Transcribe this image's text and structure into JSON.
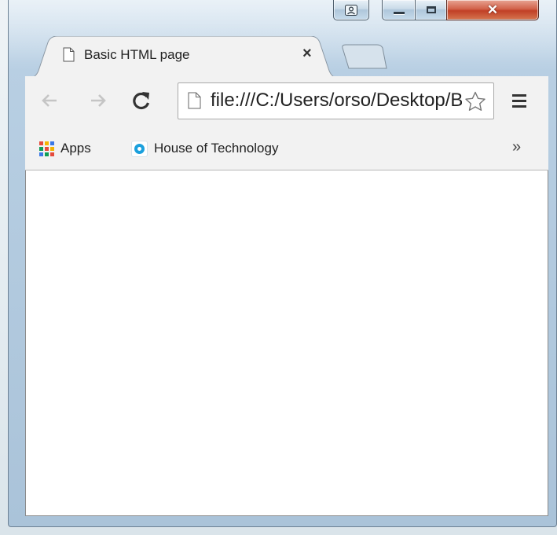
{
  "window": {
    "caption_buttons": {
      "profile": "profile-icon",
      "minimize": "minimize-icon",
      "maximize": "maximize-icon",
      "close": "close-icon"
    }
  },
  "tabs": [
    {
      "title": "Basic HTML page",
      "close_glyph": "×",
      "icon": "page-icon",
      "active": true
    }
  ],
  "toolbar": {
    "back_icon": "back-arrow-icon",
    "forward_icon": "forward-arrow-icon",
    "reload_icon": "reload-icon",
    "url": "file:///C:/Users/orso/Desktop/Basic HTML page.html",
    "star_icon": "star-icon",
    "menu_icon": "hamburger-menu-icon"
  },
  "bookmarks": {
    "items": [
      {
        "label": "Apps",
        "icon": "apps-grid-icon"
      },
      {
        "label": "House of Technology",
        "icon": "site-favicon"
      }
    ],
    "overflow_glyph": "»"
  },
  "colors": {
    "close_button": "#c13f26",
    "favicon_blue": "#1aa0dd",
    "toolbar_bg": "#f2f2f2"
  }
}
